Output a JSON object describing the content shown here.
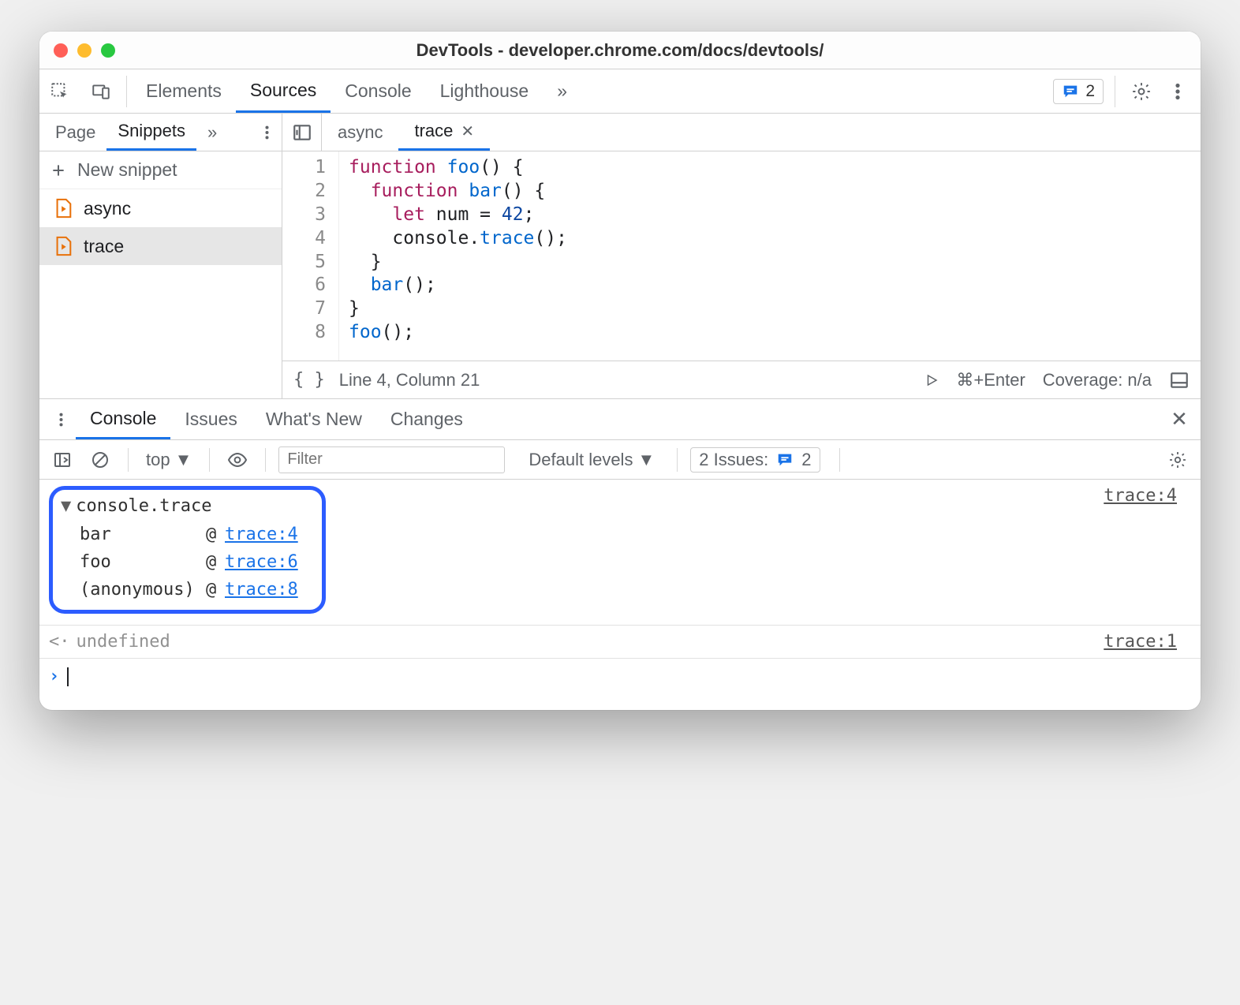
{
  "window": {
    "title": "DevTools - developer.chrome.com/docs/devtools/"
  },
  "toolbar": {
    "tabs": [
      "Elements",
      "Sources",
      "Console",
      "Lighthouse"
    ],
    "active": "Sources",
    "more": "»",
    "issues_count": "2"
  },
  "sidebar": {
    "tabs": [
      "Page",
      "Snippets"
    ],
    "active": "Snippets",
    "more": "»",
    "new_label": "New snippet",
    "files": [
      {
        "name": "async",
        "selected": false
      },
      {
        "name": "trace",
        "selected": true
      }
    ]
  },
  "editor": {
    "tabs": [
      {
        "name": "async",
        "active": false,
        "closable": false
      },
      {
        "name": "trace",
        "active": true,
        "closable": true
      }
    ],
    "code_lines": [
      "function foo() {",
      "  function bar() {",
      "    let num = 42;",
      "    console.trace();",
      "  }",
      "  bar();",
      "}",
      "foo();"
    ],
    "status": {
      "cursor": "Line 4, Column 21",
      "run_hint": "⌘+Enter",
      "coverage": "Coverage: n/a"
    }
  },
  "drawer": {
    "tabs": [
      "Console",
      "Issues",
      "What's New",
      "Changes"
    ],
    "active": "Console"
  },
  "console_toolbar": {
    "context": "top",
    "filter_placeholder": "Filter",
    "levels": "Default levels",
    "issues_label": "2 Issues:",
    "issues_count": "2"
  },
  "console": {
    "trace_title": "console.trace",
    "trace_source": "trace:4",
    "stack": [
      {
        "fn": "bar",
        "at": "trace:4"
      },
      {
        "fn": "foo",
        "at": "trace:6"
      },
      {
        "fn": "(anonymous)",
        "at": "trace:8"
      }
    ],
    "return_value": "undefined",
    "return_source": "trace:1"
  }
}
